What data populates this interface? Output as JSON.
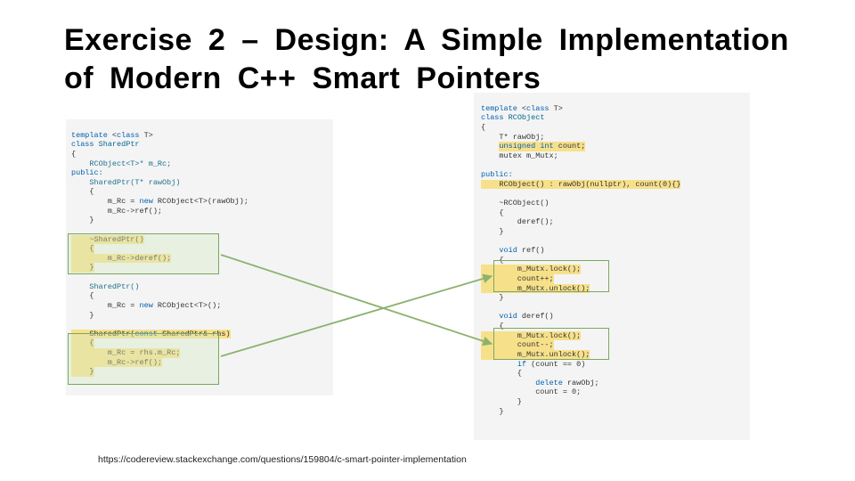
{
  "title": "Exercise 2 – Design:  A  Simple  Implementation  of Modern  C++  Smart  Pointers",
  "footer_url": "https://codereview.stackexchange.com/questions/159804/c-smart-pointer-implementation",
  "code_left": {
    "l1a": "template",
    "l1b": " <",
    "l1c": "class",
    "l1d": " T>",
    "l2a": "class",
    "l2b": " SharedPtr",
    "l3": "{",
    "l4": "    RCObject<T>* m_Rc;",
    "l5": "public:",
    "l6": "    SharedPtr(T* rawObj)",
    "l7": "    {",
    "l8a": "        m_Rc = ",
    "l8b": "new",
    "l8c": " RCObject<T>(rawObj);",
    "l9": "        m_Rc->ref();",
    "l10": "    }",
    "l11": "",
    "l12": "    ~SharedPtr()",
    "l13": "    {",
    "l14": "        m_Rc->deref();",
    "l15": "    }",
    "l16": "",
    "l17": "    SharedPtr()",
    "l18": "    {",
    "l19a": "        m_Rc = ",
    "l19b": "new",
    "l19c": " RCObject<T>();",
    "l20": "    }",
    "l21": "",
    "l22a": "    SharedPtr(",
    "l22b": "const",
    "l22c": " SharedPtr& rhs)",
    "l23": "    {",
    "l24": "        m_Rc = rhs.m_Rc;",
    "l25": "        m_Rc->ref();",
    "l26": "    }"
  },
  "code_right": {
    "l1a": "template",
    "l1b": " <",
    "l1c": "class",
    "l1d": " T>",
    "l2a": "class",
    "l2b": " RCObject",
    "l3": "{",
    "l4": "    T* rawObj;",
    "l5a": "    ",
    "l5b": "unsigned int",
    "l5c": " count;",
    "l6": "    mutex m_Mutx;",
    "l7": "",
    "l8": "public:",
    "l9": "    RCObject() : rawObj(nullptr), count(0){}",
    "l10": "",
    "l11": "    ~RCObject()",
    "l12": "    {",
    "l13": "        deref();",
    "l14": "    }",
    "l15": "",
    "l16a": "    ",
    "l16b": "void",
    "l16c": " ref()",
    "l17": "    {",
    "l18": "        m_Mutx.lock();",
    "l19": "        count++;",
    "l20": "        m_Mutx.unlock();",
    "l21": "    }",
    "l22": "",
    "l23a": "    ",
    "l23b": "void",
    "l23c": " deref()",
    "l24": "    {",
    "l25": "        m_Mutx.lock();",
    "l26": "        count--;",
    "l27": "        m_Mutx.unlock();",
    "l28a": "        ",
    "l28b": "if",
    "l28c": " (count == 0)",
    "l29": "        {",
    "l30a": "            ",
    "l30b": "delete",
    "l30c": " rawObj;",
    "l31": "            count = 0;",
    "l32": "        }",
    "l33": "    }"
  }
}
